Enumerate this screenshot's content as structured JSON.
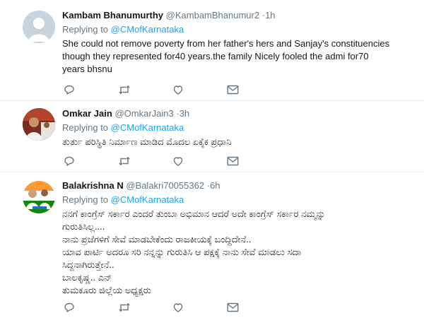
{
  "tweets": [
    {
      "name": "Kambam Bhanumurthy",
      "handle": "@KambamBhanumur2",
      "dot": "·",
      "time": "1h",
      "replying_prefix": "Replying to ",
      "replying_to": "@CMofKarnataka",
      "lines": [
        "She could not remove poverty from her father's hers and Sanjay's constituencies",
        "though they represented for40 years.the family Nicely fooled the  admi  for70",
        "years bhsnu"
      ],
      "avatar_icon": "default-profile-egg",
      "avatar_bg": "#c9d3db"
    },
    {
      "name": "Omkar Jain",
      "handle": "@OmkarJain3",
      "dot": "·",
      "time": "3h",
      "replying_prefix": "Replying to ",
      "replying_to": "@CMofKarnataka",
      "lines": [
        "ತುರ್ತು ಪರಿಸ್ಥಿತಿ ನಿರ್ಮಾಣ ಮಾಡಿದ ಮೊದಲ ಏಕೈಕ ಪ್ರಧಾನಿ"
      ],
      "avatar_icon": "user-photo",
      "avatar_bg": "#8b3a2b"
    },
    {
      "name": "Balakrishna N",
      "handle": "@Balakri70055362",
      "dot": "·",
      "time": "6h",
      "replying_prefix": "Replying to ",
      "replying_to": "@CMofKarnataka",
      "lines": [
        "ನನಗೆ ಕಾಂಗ್ರೆಸ್ ಸರ್ಕಾರ ಎಂದರೆ ತುಂಬಾ ಅಭಿಮಾನ ಆದರೆ ಅದೇ ಕಾಂಗ್ರೆಸ್ ಸರ್ಕಾರ ನಮ್ಮನ್ನು",
        "ಗುರುತಿಸಿಲ್ಲ....",
        "ನಾನು ಪ್ರಜೆಗಳಿಗೆ ಸೇವೆ ಮಾಡಬೇಕೆಂದು ರಾಜಕೀಯಕ್ಕೆ ಬಂದ್ದಿದೇನೆ..",
        " ಯಾವ ಪಾರ್ಟಿ ಅದರೂ ಸರಿ ನನ್ನನ್ನು ಗುರುತಿಸಿ ಆ ಪಕ್ಷಕ್ಕೆ ನಾನು ಸೇವೆ ಮಾಡಲು ಸದಾ",
        "ಸಿದ್ದನಾಗಿರುತ್ತೇನೆ..",
        "ಬಾಲಕೃಷ್ಣ.. ಎನ್",
        "ತುಮಕೂರು ಜಿಲ್ಲೆಯ ಅಧ್ಯಕ್ಷರು"
      ],
      "avatar_icon": "user-photo-flag",
      "avatar_bg": "#f0f0f0"
    }
  ],
  "actions": [
    "reply-icon",
    "retweet-icon",
    "like-icon",
    "message-icon"
  ],
  "colors": {
    "link": "#1da1f2",
    "secondary_text": "#657786",
    "action_icon": "#657786",
    "divider": "#e6ecf0"
  }
}
